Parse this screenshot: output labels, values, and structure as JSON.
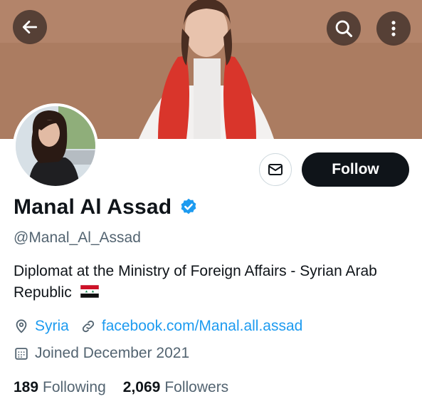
{
  "header": {
    "back_icon": "arrow-left-icon",
    "search_icon": "search-icon",
    "more_icon": "more-vertical-icon"
  },
  "actions": {
    "message_icon": "envelope-icon",
    "follow_label": "Follow"
  },
  "profile": {
    "name": "Manal Al Assad",
    "verified": true,
    "handle": "@Manal_Al_Assad",
    "bio": "Diplomat at the Ministry of Foreign  Affairs - Syrian Arab Republic",
    "bio_emoji": "syrian-flag",
    "location": "Syria",
    "website": "facebook.com/Manal.all.assad",
    "joined": "Joined December 2021"
  },
  "stats": {
    "following_count": "189",
    "following_label": "Following",
    "followers_count": "2,069",
    "followers_label": "Followers"
  },
  "colors": {
    "link": "#1d9bf0",
    "verified": "#1d9bf0",
    "follow_bg": "#0f1419",
    "secondary_text": "#536471"
  }
}
